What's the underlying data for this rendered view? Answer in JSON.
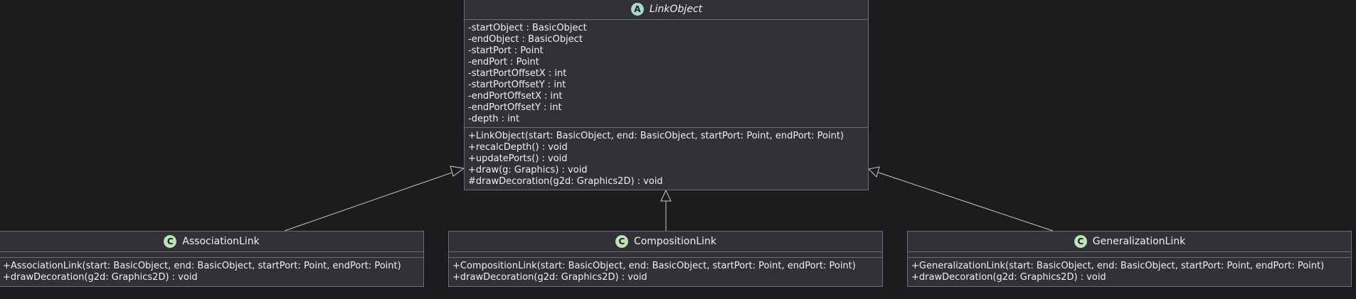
{
  "diagram": {
    "parent": {
      "name": "LinkObject",
      "stereotype_badge": "A",
      "is_abstract": true,
      "fields": [
        "-startObject : BasicObject",
        "-endObject : BasicObject",
        "-startPort : Point",
        "-endPort : Point",
        "-startPortOffsetX : int",
        "-startPortOffsetY : int",
        "-endPortOffsetX : int",
        "-endPortOffsetY : int",
        "-depth : int"
      ],
      "methods": [
        "+LinkObject(start: BasicObject, end: BasicObject, startPort: Point, endPort: Point)",
        "+recalcDepth() : void",
        "+updatePorts() : void",
        "+draw(g: Graphics) : void",
        "#drawDecoration(g2d: Graphics2D) : void"
      ]
    },
    "children": [
      {
        "name": "AssociationLink",
        "stereotype_badge": "C",
        "methods": [
          "+AssociationLink(start: BasicObject, end: BasicObject, startPort: Point, endPort: Point)",
          "+drawDecoration(g2d: Graphics2D) : void"
        ]
      },
      {
        "name": "CompositionLink",
        "stereotype_badge": "C",
        "methods": [
          "+CompositionLink(start: BasicObject, end: BasicObject, startPort: Point, endPort: Point)",
          "+drawDecoration(g2d: Graphics2D) : void"
        ]
      },
      {
        "name": "GeneralizationLink",
        "stereotype_badge": "C",
        "methods": [
          "+GeneralizationLink(start: BasicObject, end: BasicObject, startPort: Point, endPort: Point)",
          "+drawDecoration(g2d: Graphics2D) : void"
        ]
      }
    ],
    "relations": [
      {
        "from": "AssociationLink",
        "to": "LinkObject",
        "type": "generalization"
      },
      {
        "from": "CompositionLink",
        "to": "LinkObject",
        "type": "generalization"
      },
      {
        "from": "GeneralizationLink",
        "to": "LinkObject",
        "type": "generalization"
      }
    ],
    "colors": {
      "background": "#1c1c1e",
      "class_fill": "#313138",
      "border": "#6b6b74",
      "edge": "#c8c8c8",
      "abstract_badge": "#a8d7d0",
      "class_badge": "#bde1b9"
    }
  }
}
